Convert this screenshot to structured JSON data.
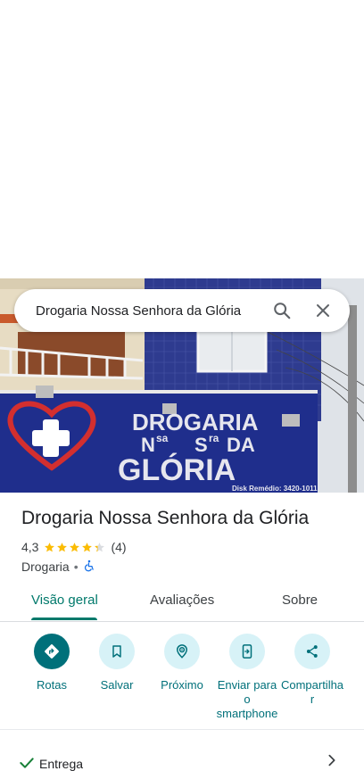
{
  "search": {
    "query": "Drogaria Nossa Senhora da Glória"
  },
  "photo": {
    "sign_line1": "DROGARIA",
    "sign_line2_a": "N",
    "sign_line2_b": "sa",
    "sign_line2_c": "S",
    "sign_line2_d": "ra",
    "sign_line2_e": "DA",
    "sign_line3": "GLÓRIA",
    "sign_phone": "Disk Remédio: 3420-1011"
  },
  "place": {
    "name": "Drogaria Nossa Senhora da Glória",
    "rating": "4,3",
    "rating_value": 4.3,
    "review_count": "(4)",
    "category": "Drogaria",
    "separator": "•"
  },
  "tabs": [
    {
      "label": "Visão geral"
    },
    {
      "label": "Avaliações"
    },
    {
      "label": "Sobre"
    }
  ],
  "actions": [
    {
      "label": "Rotas",
      "icon": "directions-icon"
    },
    {
      "label": "Salvar",
      "icon": "bookmark-icon"
    },
    {
      "label": "Próximo",
      "icon": "nearby-icon"
    },
    {
      "label": "Enviar para o smartphone",
      "icon": "send-to-phone-icon"
    },
    {
      "label": "Compartilhar",
      "icon": "share-icon"
    }
  ],
  "delivery": {
    "label": "Entrega"
  },
  "colors": {
    "accent": "#00707a",
    "tab_active": "#00796b",
    "star": "#fbbc04"
  }
}
